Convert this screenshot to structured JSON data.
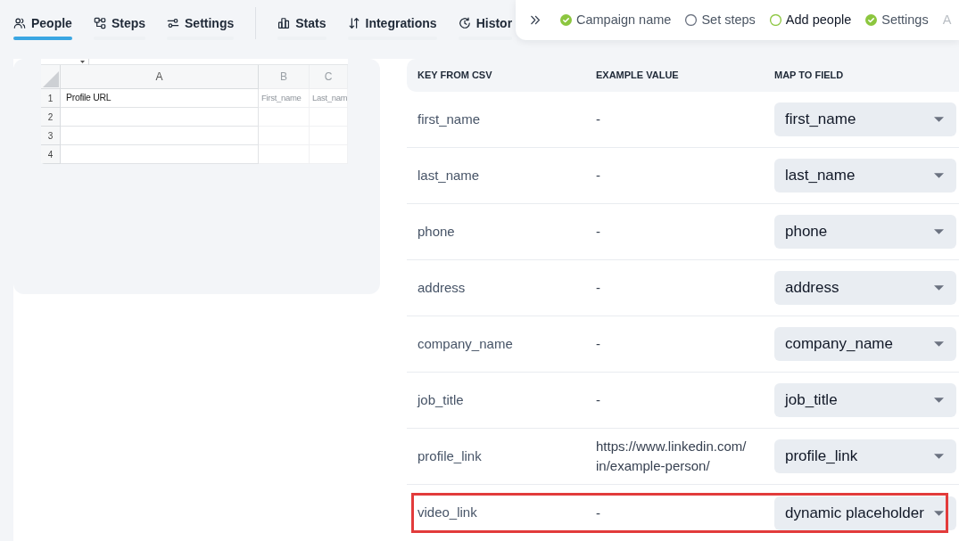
{
  "tab_groups": [
    {
      "tabs": [
        {
          "label": "People",
          "selected": true
        },
        {
          "label": "Steps",
          "selected": false
        },
        {
          "label": "Settings",
          "selected": false
        }
      ]
    },
    {
      "tabs": [
        {
          "label": "Stats",
          "selected": false
        },
        {
          "label": "Integrations",
          "selected": false
        },
        {
          "label": "Histor",
          "selected": false
        }
      ]
    }
  ],
  "progress_panel": {
    "steps": [
      {
        "label": "Campaign name",
        "done": true,
        "current": false
      },
      {
        "label": "Set steps",
        "done": false,
        "current": false
      },
      {
        "label": "Add people",
        "done": false,
        "current": true
      },
      {
        "label": "Settings",
        "done": true,
        "current": false
      }
    ],
    "cut_off_label": "A"
  },
  "spreadsheet_preview": {
    "columns": [
      "A",
      "B",
      "C"
    ],
    "rows": [
      {
        "number": "1",
        "cells": [
          "Profile URL",
          "First_name",
          "Last_nam"
        ]
      },
      {
        "number": "2"
      },
      {
        "number": "3"
      },
      {
        "number": "4"
      }
    ]
  },
  "mapping_table": {
    "columns": [
      "KEY FROM CSV",
      "EXAMPLE VALUE",
      "MAP TO FIELD"
    ],
    "rows": [
      {
        "key": "first_name",
        "example": "-",
        "field": "first_name",
        "highlighted": false
      },
      {
        "key": "last_name",
        "example": "-",
        "field": "last_name",
        "highlighted": false
      },
      {
        "key": "phone",
        "example": "-",
        "field": "phone",
        "highlighted": false
      },
      {
        "key": "address",
        "example": "-",
        "field": "address",
        "highlighted": false
      },
      {
        "key": "company_name",
        "example": "-",
        "field": "company_name",
        "highlighted": false
      },
      {
        "key": "job_title",
        "example": "-",
        "field": "job_title",
        "highlighted": false
      },
      {
        "key": "profile_link",
        "example": "https://www.linkedin.com/in/example-person/",
        "field": "profile_link",
        "highlighted": false
      },
      {
        "key": "video_link",
        "example": "-",
        "field": "dynamic placeholder",
        "highlighted": true
      }
    ]
  }
}
